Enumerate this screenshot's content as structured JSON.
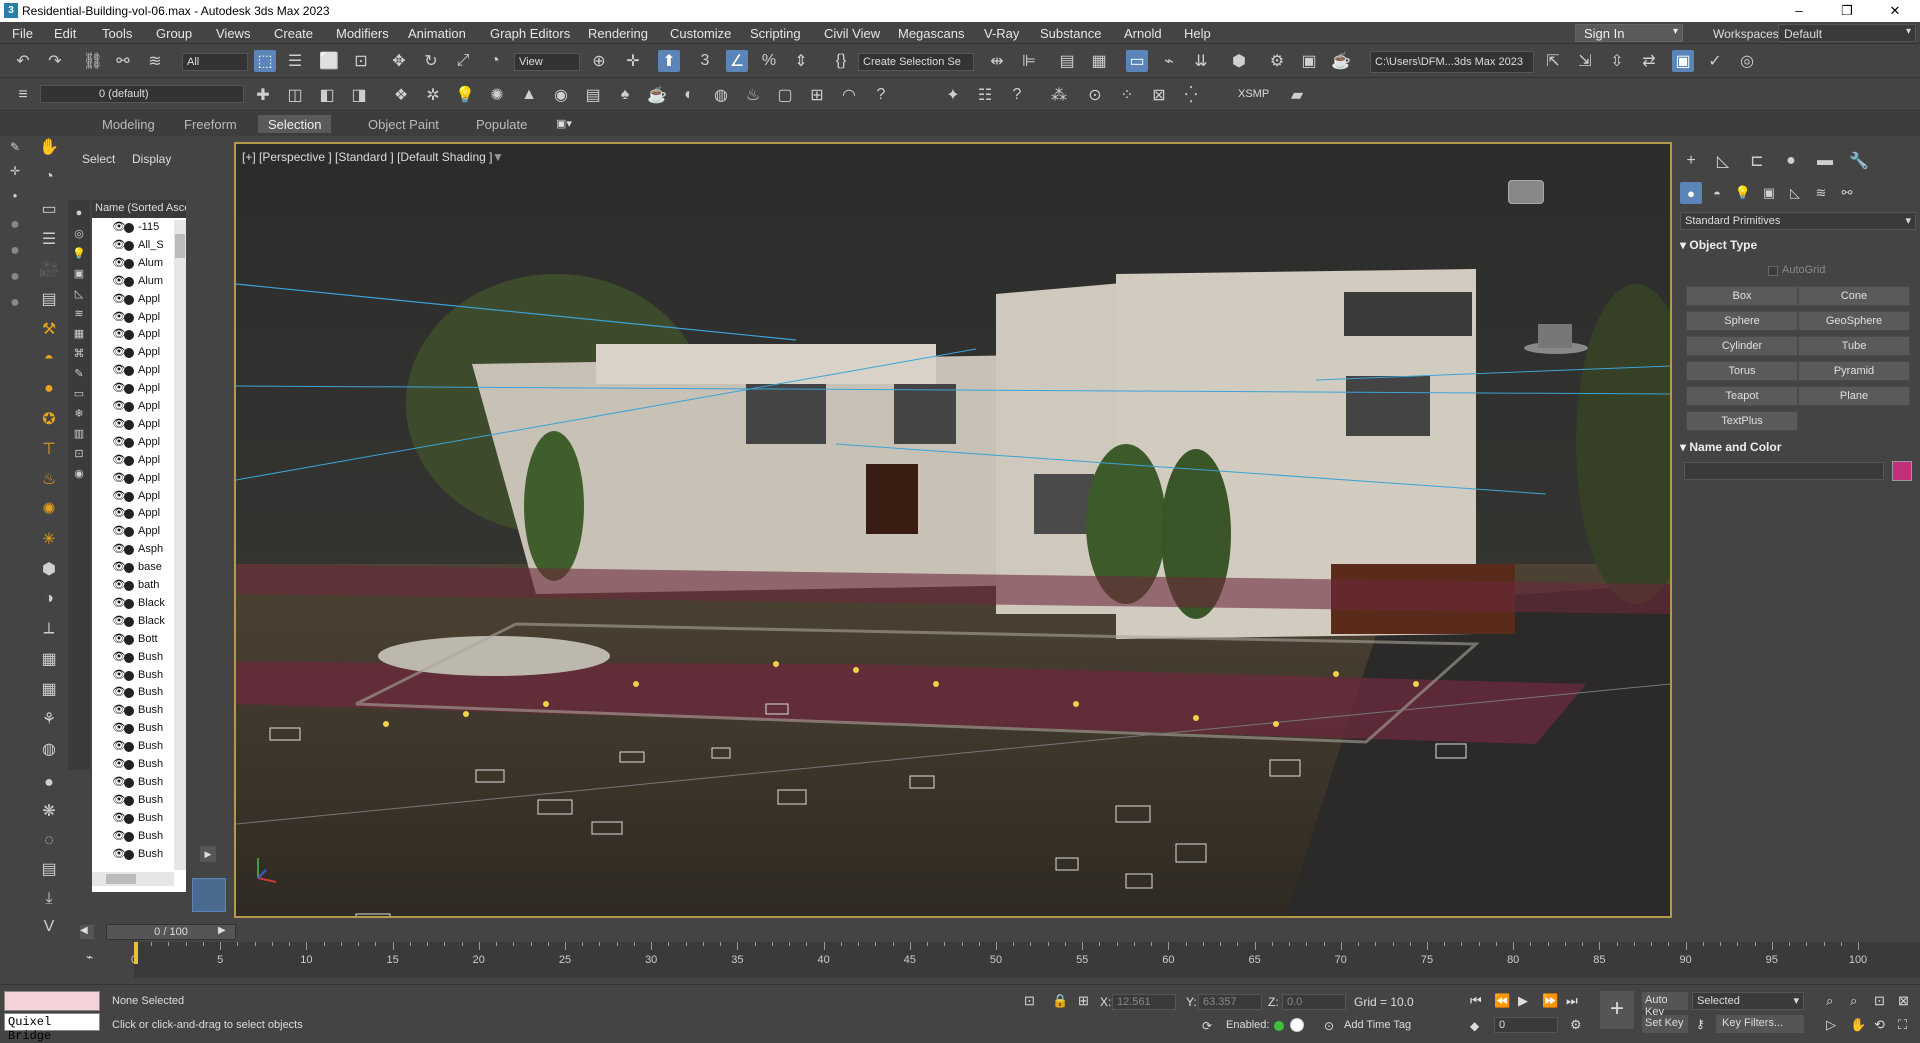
{
  "window": {
    "title": "Residential-Building-vol-06.max - Autodesk 3ds Max 2023",
    "app_icon": "3"
  },
  "menu": [
    "File",
    "Edit",
    "Tools",
    "Group",
    "Views",
    "Create",
    "Modifiers",
    "Animation",
    "Graph Editors",
    "Rendering",
    "Customize",
    "Scripting",
    "Civil View",
    "Megascans",
    "V-Ray",
    "Substance",
    "Arnold",
    "Help"
  ],
  "signin": "Sign In",
  "workspace": {
    "label": "Workspaces:",
    "value": "Default"
  },
  "toolbar1": {
    "filter_select": "All",
    "ref_coord": "View",
    "named_selection": "Create Selection Se",
    "project_path": "C:\\Users\\DFM...3ds Max 2023"
  },
  "toolbar2": {
    "layer": "0 (default)",
    "xsmp": "XSMP"
  },
  "ribbon_tabs": [
    "Modeling",
    "Freeform",
    "Selection",
    "Object Paint",
    "Populate"
  ],
  "ribbon_selected": "Selection",
  "scene_explorer": {
    "tabs": [
      "Select",
      "Display"
    ],
    "column_header": "Name (Sorted Ascending)",
    "rows": [
      "-115",
      "All_S",
      "Alum",
      "Alum",
      "Appl",
      "Appl",
      "Appl",
      "Appl",
      "Appl",
      "Appl",
      "Appl",
      "Appl",
      "Appl",
      "Appl",
      "Appl",
      "Appl",
      "Appl",
      "Appl",
      "Asph",
      "base",
      "bath",
      "Black",
      "Black",
      "Bott",
      "Bush",
      "Bush",
      "Bush",
      "Bush",
      "Bush",
      "Bush",
      "Bush",
      "Bush",
      "Bush",
      "Bush",
      "Bush",
      "Bush"
    ]
  },
  "viewport": {
    "label": "[+] [Perspective ] [Standard ] [Default Shading ]"
  },
  "command_panel": {
    "category": "Standard Primitives",
    "object_type_title": "Object Type",
    "autogrid": "AutoGrid",
    "buttons": [
      "Box",
      "Cone",
      "Sphere",
      "GeoSphere",
      "Cylinder",
      "Tube",
      "Torus",
      "Pyramid",
      "Teapot",
      "Plane",
      "TextPlus"
    ],
    "name_color_title": "Name and Color",
    "object_color": "#c2307a"
  },
  "timeline": {
    "frame_display": "0 / 100",
    "ticks": [
      "0",
      "5",
      "10",
      "15",
      "20",
      "25",
      "30",
      "35",
      "40",
      "45",
      "50",
      "55",
      "60",
      "65",
      "70",
      "75",
      "80",
      "85",
      "90",
      "95",
      "100"
    ],
    "current_frame": 0
  },
  "status": {
    "quixel": "Quixel Bridge",
    "selection": "None Selected",
    "prompt": "Click or click-and-drag to select objects",
    "x_label": "X:",
    "x_value": "12.561",
    "y_label": "Y:",
    "y_value": "63.357",
    "z_label": "Z:",
    "z_value": "0.0",
    "grid": "Grid = 10.0",
    "enabled_label": "Enabled:",
    "add_time_tag": "Add Time Tag",
    "auto_key": "Auto Key",
    "key_mode": "Selected",
    "set_key": "Set Key",
    "key_filters": "Key Filters...",
    "frame": "0"
  },
  "colors": {
    "accent": "#5b84b8",
    "viewport_border": "#b59a4c",
    "status_pink": "#f4d2d8"
  }
}
